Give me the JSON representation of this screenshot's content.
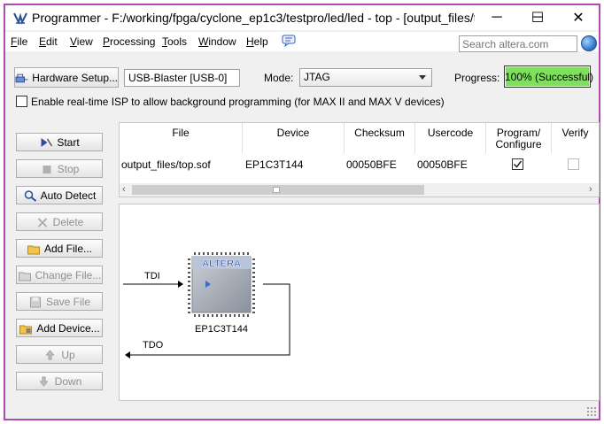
{
  "window": {
    "title": "Programmer - F:/working/fpga/cyclone_ep1c3/testpro/led/led - top - [output_files/to...",
    "minimize": "─",
    "maximize": "☐",
    "close": "✕"
  },
  "menu": {
    "items": [
      {
        "key": "F",
        "rest": "ile"
      },
      {
        "key": "E",
        "rest": "dit"
      },
      {
        "key": "V",
        "rest": "iew"
      },
      {
        "key": "P",
        "rest": "rocessing"
      },
      {
        "key": "T",
        "rest": "ools"
      },
      {
        "key": "W",
        "rest": "indow"
      },
      {
        "key": "H",
        "rest": "elp"
      }
    ],
    "search_placeholder": "Search altera.com"
  },
  "toolbar": {
    "hardware_setup": "Hardware Setup...",
    "hardware_value": "USB-Blaster [USB-0]",
    "mode_label": "Mode:",
    "mode_value": "JTAG",
    "progress_label": "Progress:",
    "progress_text": "100% (Successful)",
    "progress_value": 1.0,
    "progress_color": "#7ee05c",
    "isp_label": "Enable real-time ISP to allow background programming (for MAX II and MAX V devices)",
    "isp_checked": false
  },
  "sidebar": {
    "buttons": [
      {
        "label": "Start",
        "enabled": true,
        "icon": "start-icon"
      },
      {
        "label": "Stop",
        "enabled": false,
        "icon": "stop-icon"
      },
      {
        "label": "Auto Detect",
        "enabled": true,
        "icon": "auto-detect-icon"
      },
      {
        "label": "Delete",
        "enabled": false,
        "icon": "delete-icon"
      },
      {
        "label": "Add File...",
        "enabled": true,
        "icon": "add-file-icon"
      },
      {
        "label": "Change File...",
        "enabled": false,
        "icon": "change-file-icon"
      },
      {
        "label": "Save File",
        "enabled": false,
        "icon": "save-file-icon"
      },
      {
        "label": "Add Device...",
        "enabled": true,
        "icon": "add-device-icon"
      },
      {
        "label": "Up",
        "enabled": false,
        "icon": "up-icon"
      },
      {
        "label": "Down",
        "enabled": false,
        "icon": "down-icon"
      }
    ]
  },
  "table": {
    "columns": [
      "File",
      "Device",
      "Checksum",
      "Usercode",
      "Program/ Configure",
      "Verify"
    ],
    "rows": [
      {
        "file": "output_files/top.sof",
        "device": "EP1C3T144",
        "checksum": "00050BFE",
        "usercode": "00050BFE",
        "program": true,
        "verify": false
      }
    ]
  },
  "diagram": {
    "chip_logo": "ALTERA",
    "chip_label": "EP1C3T144",
    "tdi": "TDI",
    "tdo": "TDO"
  }
}
